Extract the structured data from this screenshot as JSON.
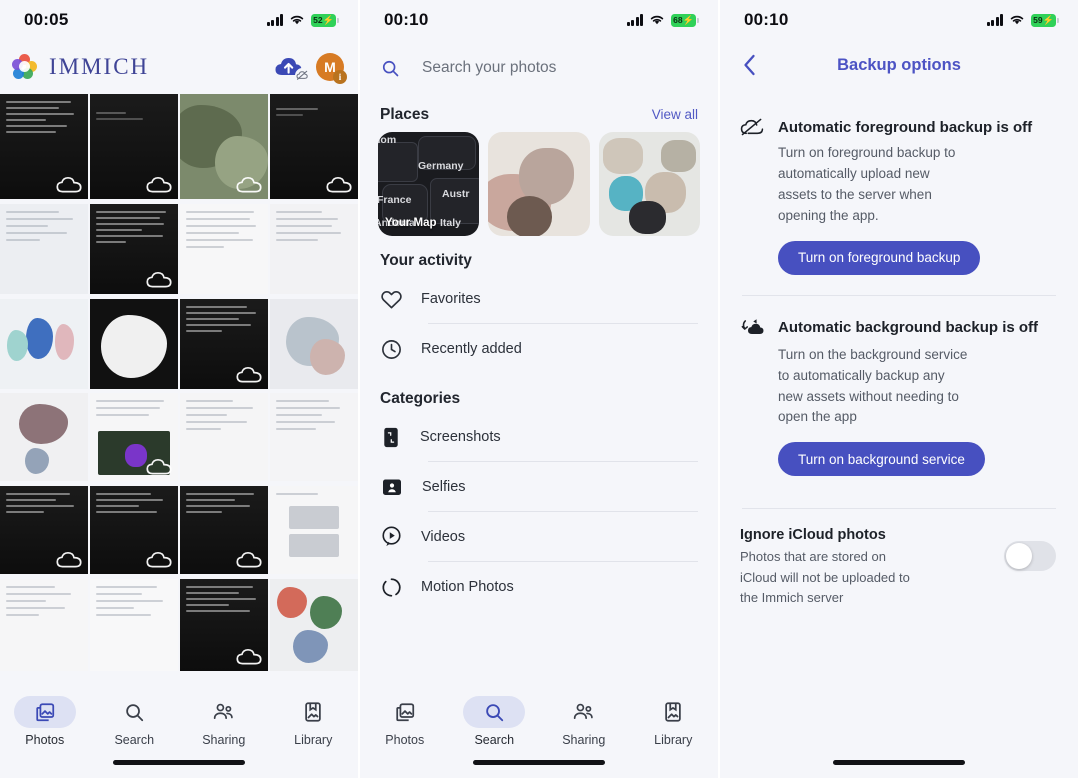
{
  "panels": {
    "photos": {
      "status": {
        "time": "00:05",
        "battery": "52",
        "charging": true
      },
      "app_name": "IMMICH",
      "icons": {
        "upload": "cloud-upload-icon",
        "backup_off": "cloud-off-badge-icon",
        "avatar_letter": "M",
        "avatar_badge": "i"
      },
      "tabs": [
        {
          "label": "Photos",
          "icon": "photos-icon",
          "active": true
        },
        {
          "label": "Search",
          "icon": "search-icon",
          "active": false
        },
        {
          "label": "Sharing",
          "icon": "sharing-icon",
          "active": false
        },
        {
          "label": "Library",
          "icon": "library-icon",
          "active": false
        }
      ]
    },
    "search": {
      "status": {
        "time": "00:10",
        "battery": "68",
        "charging": true
      },
      "search_placeholder": "Search your photos",
      "places": {
        "title": "Places",
        "view_all": "View all",
        "map_label": "Your Map",
        "map_countries": [
          "dom",
          "Germany",
          "France",
          "Austr",
          "Andorra",
          "Italy"
        ]
      },
      "activity": {
        "title": "Your activity",
        "items": [
          {
            "label": "Favorites",
            "icon": "heart-icon"
          },
          {
            "label": "Recently added",
            "icon": "clock-icon"
          }
        ]
      },
      "categories": {
        "title": "Categories",
        "items": [
          {
            "label": "Screenshots",
            "icon": "screenshot-icon"
          },
          {
            "label": "Selfies",
            "icon": "selfie-icon"
          },
          {
            "label": "Videos",
            "icon": "video-play-icon"
          },
          {
            "label": "Motion Photos",
            "icon": "motion-photo-icon"
          }
        ]
      },
      "tabs": [
        {
          "label": "Photos",
          "icon": "photos-icon",
          "active": false
        },
        {
          "label": "Search",
          "icon": "search-icon",
          "active": true
        },
        {
          "label": "Sharing",
          "icon": "sharing-icon",
          "active": false
        },
        {
          "label": "Library",
          "icon": "library-icon",
          "active": false
        }
      ]
    },
    "backup": {
      "status": {
        "time": "00:10",
        "battery": "59",
        "charging": true
      },
      "nav_title": "Backup options",
      "back_icon": "chevron-left-icon",
      "foreground": {
        "icon": "cloud-off-icon",
        "title": "Automatic foreground backup is off",
        "body": "Turn on foreground backup to automatically upload new assets to the server when opening the app.",
        "button": "Turn on foreground backup"
      },
      "background": {
        "icon": "cloud-sync-icon",
        "title": "Automatic background backup is off",
        "body": "Turn on the background service to automatically backup any new assets without needing to open the app",
        "button": "Turn on background service"
      },
      "icloud": {
        "title": "Ignore iCloud photos",
        "body": "Photos that are stored on iCloud will not be uploaded to the Immich server",
        "toggle_on": false
      }
    }
  },
  "colors": {
    "brand": "#4750c0",
    "accent_link": "#5159c4",
    "page_bg": "#f5f6fa",
    "battery_green": "#30d158",
    "avatar_orange": "#d77b24"
  }
}
